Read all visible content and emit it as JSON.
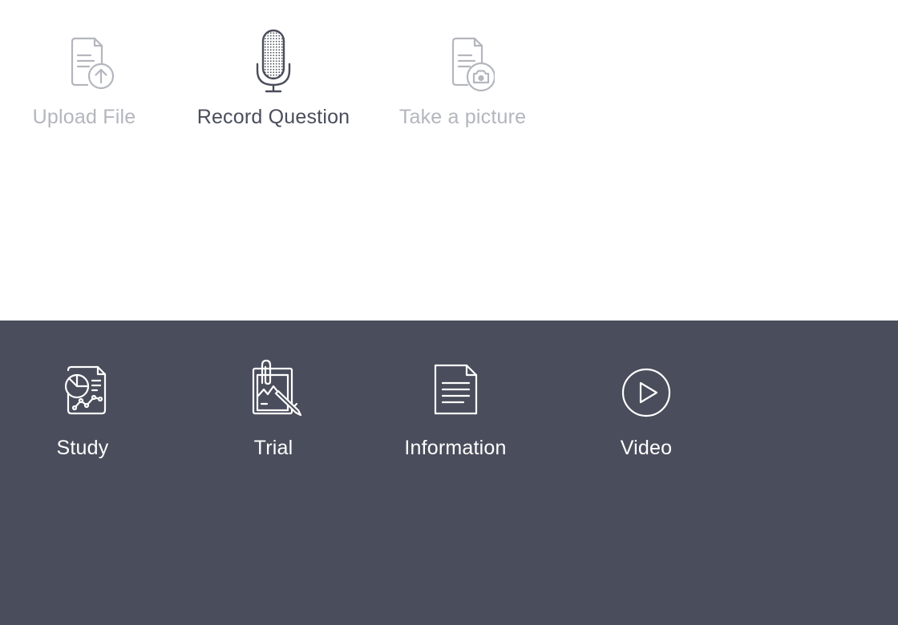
{
  "input_options": [
    {
      "label": "Upload File",
      "icon": "file-upload-icon",
      "state": "disabled"
    },
    {
      "label": "Record Question",
      "icon": "microphone-icon",
      "state": "active"
    },
    {
      "label": "Take a picture",
      "icon": "file-camera-icon",
      "state": "disabled"
    }
  ],
  "categories": [
    {
      "label": "Study",
      "icon": "report-chart-icon"
    },
    {
      "label": "Trial",
      "icon": "clipboard-pen-icon"
    },
    {
      "label": "Information",
      "icon": "document-icon"
    },
    {
      "label": "Video",
      "icon": "play-circle-icon"
    }
  ],
  "colors": {
    "panel_background": "#4a4d5b",
    "disabled_text": "#b4b6bd",
    "active_text": "#4a4d5b",
    "inverse_text": "#ffffff"
  }
}
